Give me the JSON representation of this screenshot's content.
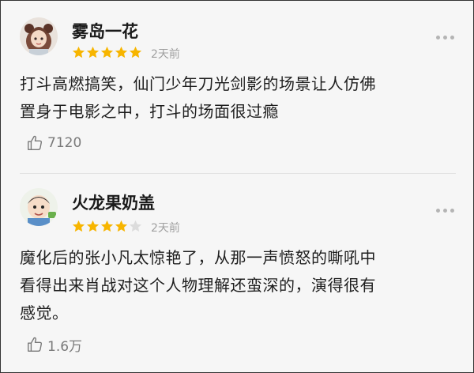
{
  "comments": [
    {
      "username": "雾岛一花",
      "rating": 5,
      "time": "2天前",
      "text_lines": [
        "打斗高燃搞笑，仙门少年刀光剑影的场景让人仿佛",
        "置身于电影之中，打斗的场面很过瘾"
      ],
      "likes": "7120",
      "avatar": "anime-girl-avatar"
    },
    {
      "username": "火龙果奶盖",
      "rating": 4,
      "time": "2天前",
      "text_lines": [
        "魔化后的张小凡太惊艳了，从那一声愤怒的嘶吼中",
        "看得出来肖战对这个人物理解还蛮深的，演得很有",
        "感觉。"
      ],
      "likes": "1.6万",
      "avatar": "child-avatar"
    }
  ],
  "colors": {
    "star_filled": "#f7b500",
    "star_empty": "#dcdcdc",
    "text": "#1e1e1e",
    "muted": "#a0a0a0"
  }
}
